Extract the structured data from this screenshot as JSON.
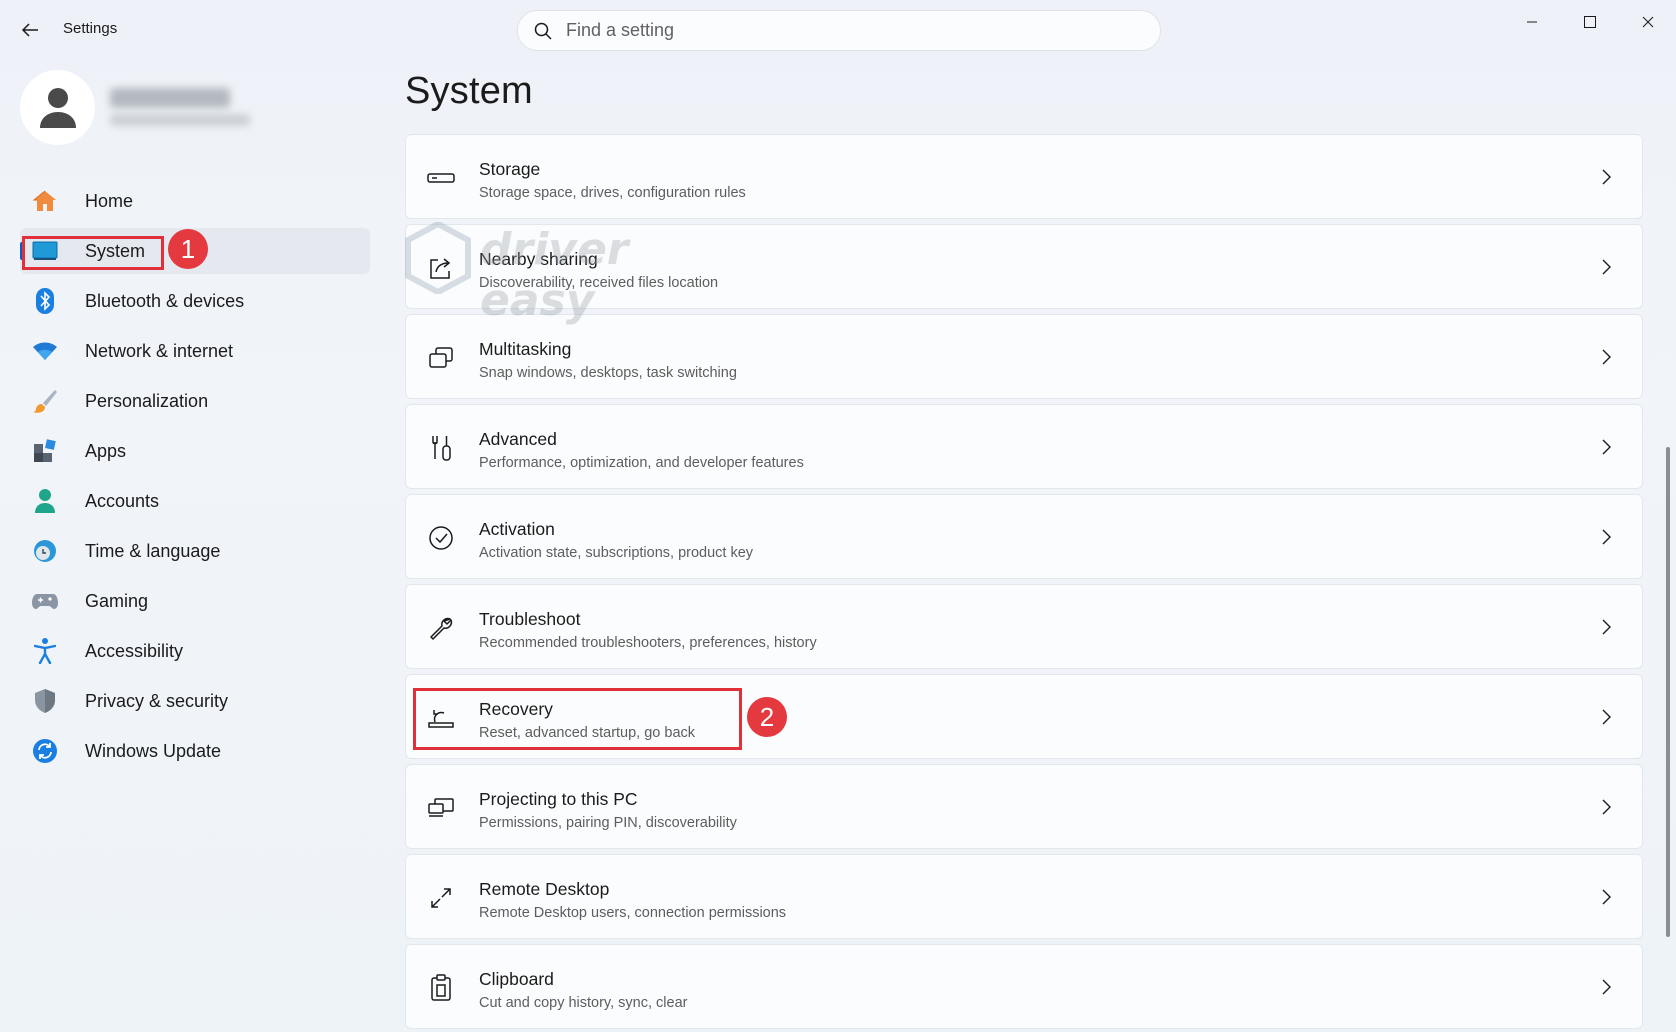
{
  "window": {
    "title": "Settings",
    "controls": {
      "minimize": "minimize",
      "maximize": "maximize",
      "close": "close"
    }
  },
  "search": {
    "placeholder": "Find a setting"
  },
  "sidebar": {
    "items": [
      {
        "label": "Home",
        "icon": "home-icon"
      },
      {
        "label": "System",
        "icon": "system-icon",
        "active": true
      },
      {
        "label": "Bluetooth & devices",
        "icon": "bluetooth-icon"
      },
      {
        "label": "Network & internet",
        "icon": "wifi-icon"
      },
      {
        "label": "Personalization",
        "icon": "brush-icon"
      },
      {
        "label": "Apps",
        "icon": "apps-icon"
      },
      {
        "label": "Accounts",
        "icon": "accounts-icon"
      },
      {
        "label": "Time & language",
        "icon": "time-language-icon"
      },
      {
        "label": "Gaming",
        "icon": "gamepad-icon"
      },
      {
        "label": "Accessibility",
        "icon": "accessibility-icon"
      },
      {
        "label": "Privacy & security",
        "icon": "shield-icon"
      },
      {
        "label": "Windows Update",
        "icon": "update-icon"
      }
    ]
  },
  "main": {
    "title": "System",
    "items": [
      {
        "title": "Storage",
        "subtitle": "Storage space, drives, configuration rules",
        "icon": "storage-icon"
      },
      {
        "title": "Nearby sharing",
        "subtitle": "Discoverability, received files location",
        "icon": "share-icon"
      },
      {
        "title": "Multitasking",
        "subtitle": "Snap windows, desktops, task switching",
        "icon": "multitasking-icon"
      },
      {
        "title": "Advanced",
        "subtitle": "Performance, optimization, and developer features",
        "icon": "tools-icon"
      },
      {
        "title": "Activation",
        "subtitle": "Activation state, subscriptions, product key",
        "icon": "check-circle-icon"
      },
      {
        "title": "Troubleshoot",
        "subtitle": "Recommended troubleshooters, preferences, history",
        "icon": "wrench-icon"
      },
      {
        "title": "Recovery",
        "subtitle": "Reset, advanced startup, go back",
        "icon": "recovery-icon"
      },
      {
        "title": "Projecting to this PC",
        "subtitle": "Permissions, pairing PIN, discoverability",
        "icon": "projecting-icon"
      },
      {
        "title": "Remote Desktop",
        "subtitle": "Remote Desktop users, connection permissions",
        "icon": "remote-desktop-icon"
      },
      {
        "title": "Clipboard",
        "subtitle": "Cut and copy history, sync, clear",
        "icon": "clipboard-icon"
      }
    ]
  },
  "annotations": {
    "step1": "1",
    "step2": "2"
  },
  "watermark": {
    "text": "driver easy"
  },
  "colors": {
    "accent": "#0f5bc4",
    "annotation": "#e0313a"
  }
}
